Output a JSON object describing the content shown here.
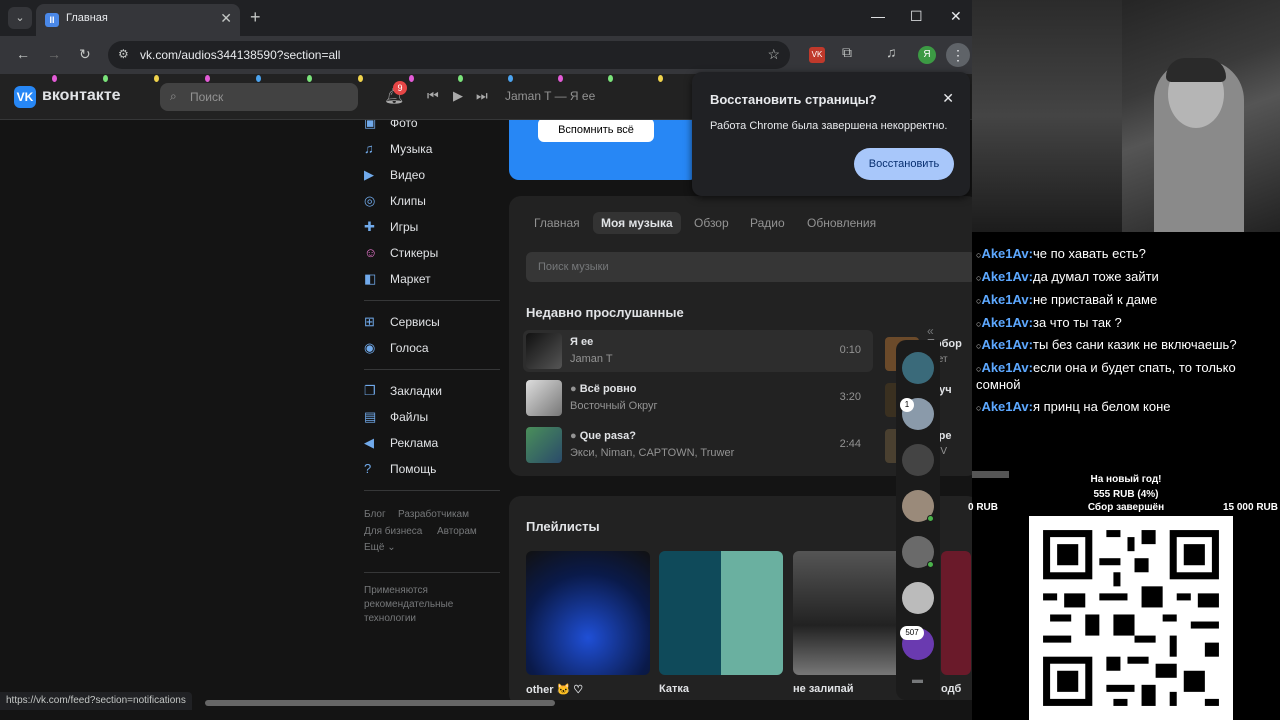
{
  "browser": {
    "tab_title": "Главная",
    "url": "vk.com/audios344138590?section=all",
    "status_url": "https://vk.com/feed?section=notifications",
    "profile_letter": "Я"
  },
  "vk": {
    "logo_text": "вконтакте",
    "search_placeholder": "Поиск",
    "notifications_count": "9",
    "now_playing": "Jaman T — Я ее",
    "nav": [
      {
        "label": "Фото",
        "icon": "photo-icon"
      },
      {
        "label": "Музыка",
        "icon": "music-icon"
      },
      {
        "label": "Видео",
        "icon": "video-icon"
      },
      {
        "label": "Клипы",
        "icon": "clips-icon"
      },
      {
        "label": "Игры",
        "icon": "games-icon"
      },
      {
        "label": "Стикеры",
        "icon": "stickers-icon"
      },
      {
        "label": "Маркет",
        "icon": "market-icon"
      },
      {
        "label": "Сервисы",
        "icon": "services-icon"
      },
      {
        "label": "Голоса",
        "icon": "votes-icon"
      },
      {
        "label": "Закладки",
        "icon": "bookmarks-icon"
      },
      {
        "label": "Файлы",
        "icon": "files-icon"
      },
      {
        "label": "Реклама",
        "icon": "ads-icon"
      },
      {
        "label": "Помощь",
        "icon": "help-icon"
      }
    ],
    "footer_links": [
      "Блог",
      "Разработчикам",
      "Для бизнеса",
      "Авторам",
      "Ещё ⌄"
    ],
    "recommend_text": "Применяются рекомендательные технологии",
    "banner_button": "Вспомнить всё",
    "music_tabs": [
      "Главная",
      "Моя музыка",
      "Обзор",
      "Радио",
      "Обновления"
    ],
    "music_search_placeholder": "Поиск музыки",
    "recent_title": "Недавно прослушанные",
    "tracks": [
      {
        "title": "Я ее",
        "artist": "Jaman T",
        "duration": "0:10"
      },
      {
        "title": "Всё ровно",
        "artist": "Восточный Округ",
        "duration": "3:20"
      },
      {
        "title": "Que pasa?",
        "artist": "Экси, Niman, CAPTOWN, Truwer",
        "duration": "2:44"
      }
    ],
    "side_tracks": [
      {
        "title": "Побор",
        "artist": "овет"
      },
      {
        "title": "злуч",
        "artist": ""
      },
      {
        "title": "утре",
        "artist": "ny V"
      }
    ],
    "playlists_title": "Плейлисты",
    "playlists": [
      {
        "name": "other 🐱 ♡"
      },
      {
        "name": "Катка"
      },
      {
        "name": "не залипай"
      },
      {
        "name": "одб"
      }
    ],
    "avatar_badges": [
      "1",
      "507"
    ]
  },
  "restore": {
    "title": "Восстановить страницы?",
    "message": "Работа Chrome была завершена некорректно.",
    "button": "Восстановить"
  },
  "chat": [
    {
      "user": "Ake1Av:",
      "text": "че по хавать есть?"
    },
    {
      "user": "Ake1Av:",
      "text": "да думал тоже зайти"
    },
    {
      "user": "Ake1Av:",
      "text": "не приставай к даме"
    },
    {
      "user": "Ake1Av:",
      "text": "за что ты так ?"
    },
    {
      "user": "Ake1Av:",
      "text": "ты без сани казик не включаешь?"
    },
    {
      "user": "Ake1Av:",
      "text": "если она и будет спать, то только сомной"
    },
    {
      "user": "Ake1Av:",
      "text": "я принц на белом коне"
    }
  ],
  "donation": {
    "title": "На новый год!",
    "amount": "555 RUB (4%)",
    "min": "0 RUB",
    "status": "Сбор завершён",
    "max": "15 000 RUB",
    "progress": 0.04
  },
  "colors": {
    "vk_accent": "#2787f5",
    "chat_user": "#5da8ff",
    "restore_button": "#a8c7fa"
  }
}
